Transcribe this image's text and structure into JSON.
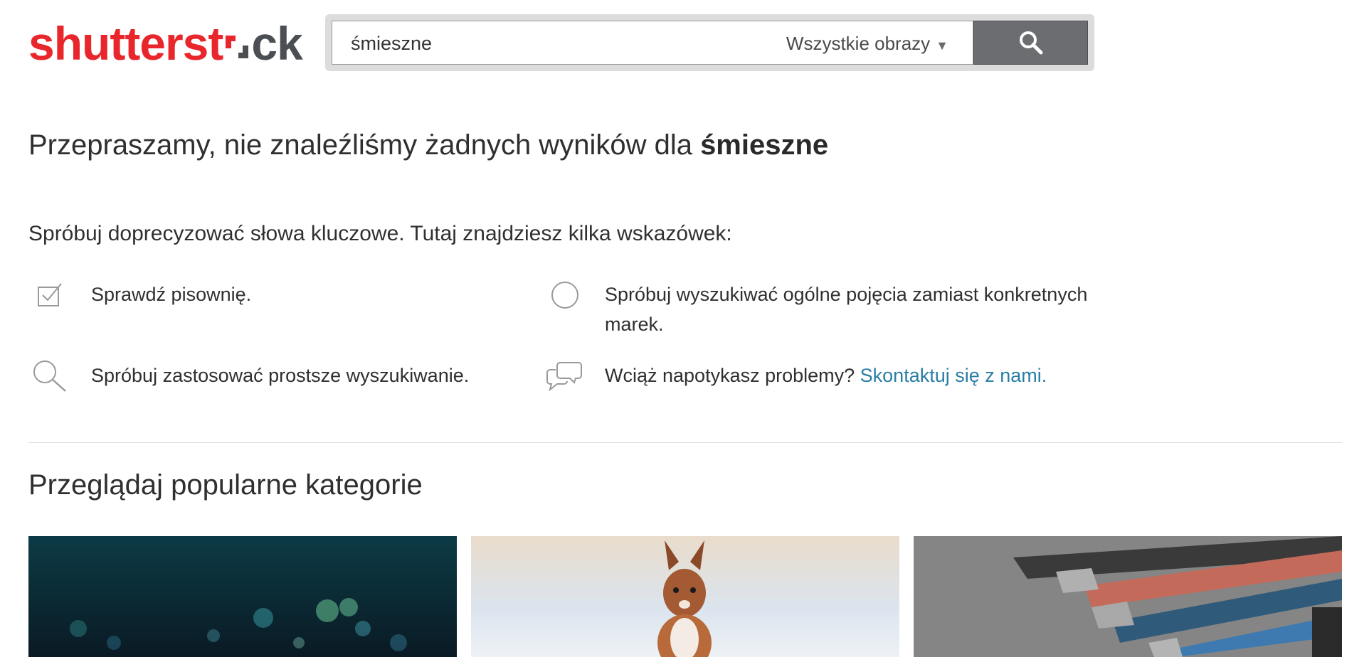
{
  "header": {
    "logo_part1": "shutterst",
    "logo_part2": "ck",
    "search_value": "śmieszne",
    "search_scope": "Wszystkie obrazy",
    "search_icon": "search-icon"
  },
  "message": {
    "headline_prefix": "Przepraszamy, nie znaleźliśmy żadnych wyników dla ",
    "search_term": "śmieszne",
    "intro": "Spróbuj doprecyzować słowa kluczowe. Tutaj znajdziesz kilka wskazówek:"
  },
  "tips": [
    {
      "icon": "checkbox-icon",
      "text": "Sprawdź pisownię."
    },
    {
      "icon": "circle-icon",
      "text": "Spróbuj wyszukiwać ogólne pojęcia zamiast konkretnych marek."
    },
    {
      "icon": "magnifier-icon",
      "text": "Spróbuj zastosować prostsze wyszukiwanie."
    },
    {
      "icon": "chat-bubbles-icon",
      "text": "Wciąż napotykasz problemy? ",
      "link": "Skontaktuj się z nami."
    }
  ],
  "categories": {
    "title": "Przeglądaj popularne kategorie"
  },
  "colors": {
    "brand_red": "#e8262b",
    "logo_gray": "#4b4f54",
    "link": "#2a7ea6",
    "search_button": "#6c6d70"
  }
}
